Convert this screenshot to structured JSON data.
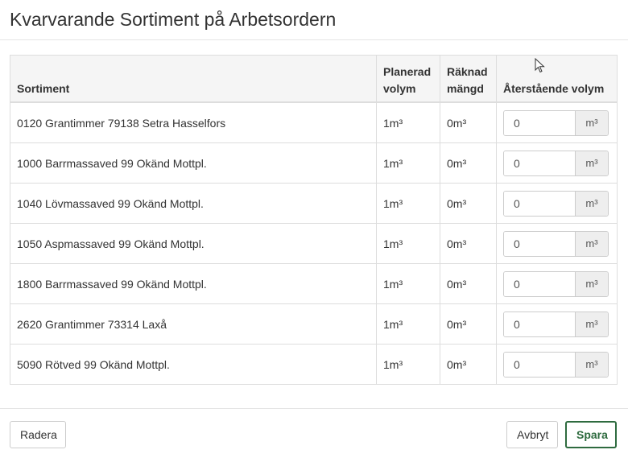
{
  "dialog": {
    "title": "Kvarvarande Sortiment på Arbetsordern"
  },
  "table": {
    "headers": {
      "sortiment": "Sortiment",
      "planerad_line1": "Planerad",
      "planerad_line2": "volym",
      "raknad_line1": "Räknad",
      "raknad_line2": "mängd",
      "aterstaende": "Återstående volym"
    },
    "unit_addon": "m³",
    "rows": [
      {
        "sortiment": "0120 Grantimmer 79138 Setra Hasselfors",
        "planerad": "1m³",
        "raknad": "0m³",
        "aterstaende": "0"
      },
      {
        "sortiment": "1000 Barrmassaved 99 Okänd Mottpl.",
        "planerad": "1m³",
        "raknad": "0m³",
        "aterstaende": "0"
      },
      {
        "sortiment": "1040 Lövmassaved 99 Okänd Mottpl.",
        "planerad": "1m³",
        "raknad": "0m³",
        "aterstaende": "0"
      },
      {
        "sortiment": "1050 Aspmassaved 99 Okänd Mottpl.",
        "planerad": "1m³",
        "raknad": "0m³",
        "aterstaende": "0"
      },
      {
        "sortiment": "1800 Barrmassaved 99 Okänd Mottpl.",
        "planerad": "1m³",
        "raknad": "0m³",
        "aterstaende": "0"
      },
      {
        "sortiment": "2620 Grantimmer 73314 Laxå",
        "planerad": "1m³",
        "raknad": "0m³",
        "aterstaende": "0"
      },
      {
        "sortiment": "5090 Rötved 99 Okänd Mottpl.",
        "planerad": "1m³",
        "raknad": "0m³",
        "aterstaende": "0"
      }
    ]
  },
  "footer": {
    "delete_label": "Radera",
    "cancel_label": "Avbryt",
    "save_label": "Spara"
  },
  "colors": {
    "primary_accent": "#2e6b3f",
    "header_bg": "#f5f5f5",
    "border": "#dddddd"
  }
}
